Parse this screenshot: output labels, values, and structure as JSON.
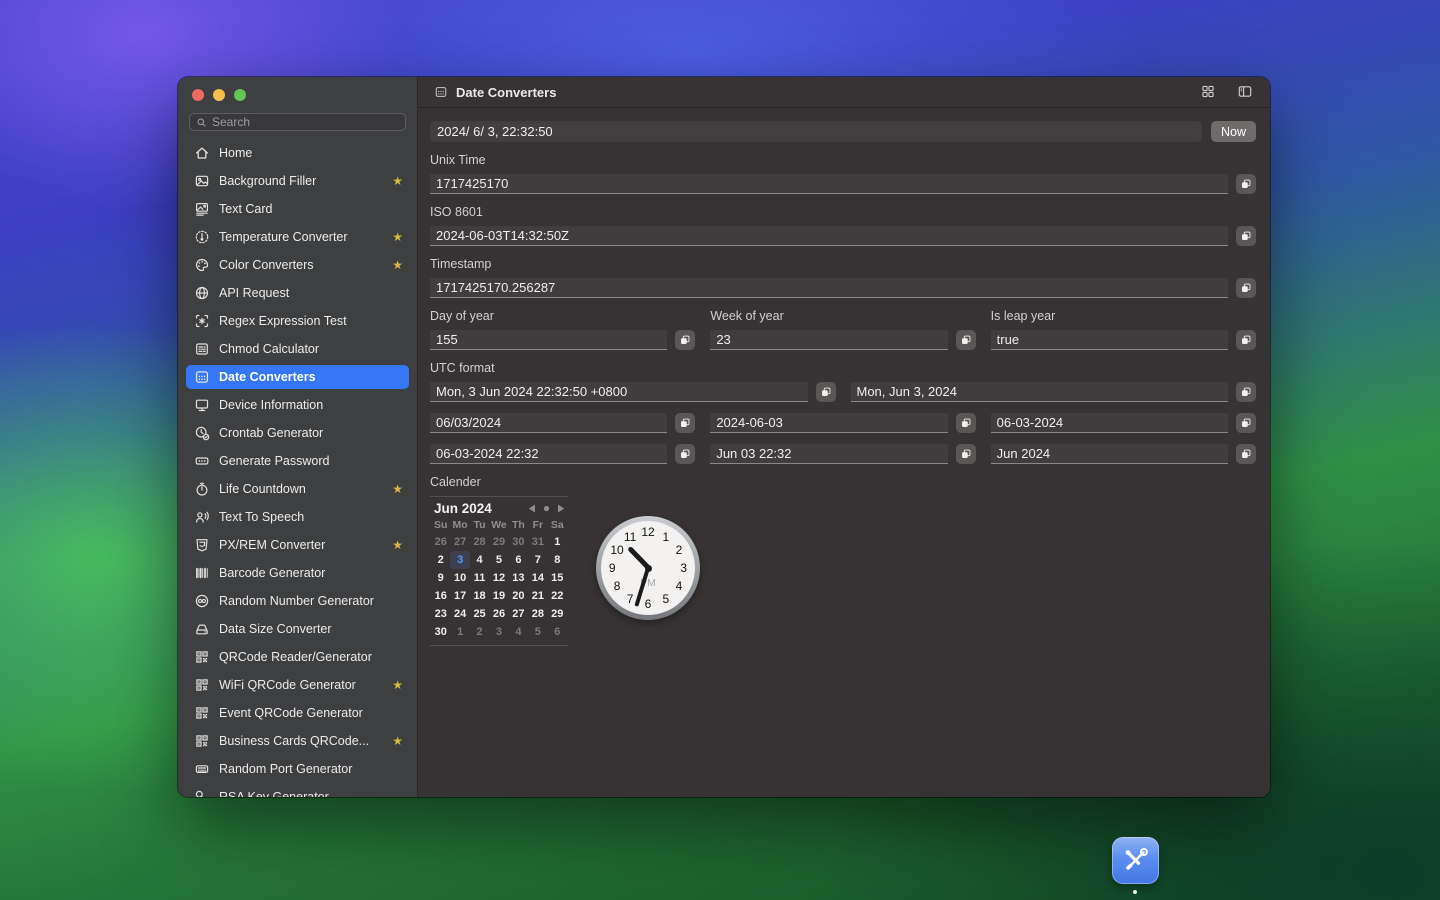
{
  "colors": {
    "accent": "#3577f6",
    "star_gold": "#d7b83d",
    "selected_day": "#4f9cf8"
  },
  "window": {
    "sidebar": {
      "search_placeholder": "Search",
      "items": [
        {
          "label": "Home",
          "icon": "home-icon",
          "starred": false,
          "selected": false
        },
        {
          "label": "Background Filler",
          "icon": "image-icon",
          "starred": true,
          "selected": false
        },
        {
          "label": "Text Card",
          "icon": "text-card-icon",
          "starred": false,
          "selected": false
        },
        {
          "label": "Temperature Converter",
          "icon": "thermometer-icon",
          "starred": true,
          "selected": false
        },
        {
          "label": "Color Converters",
          "icon": "palette-icon",
          "starred": true,
          "selected": false
        },
        {
          "label": "API Request",
          "icon": "globe-icon",
          "starred": false,
          "selected": false
        },
        {
          "label": "Regex Expression Test",
          "icon": "regex-icon",
          "starred": false,
          "selected": false
        },
        {
          "label": "Chmod Calculator",
          "icon": "chmod-icon",
          "starred": false,
          "selected": false
        },
        {
          "label": "Date Converters",
          "icon": "calendar-icon",
          "starred": false,
          "selected": true
        },
        {
          "label": "Device Information",
          "icon": "device-icon",
          "starred": false,
          "selected": false
        },
        {
          "label": "Crontab Generator",
          "icon": "crontab-icon",
          "starred": false,
          "selected": false
        },
        {
          "label": "Generate Password",
          "icon": "password-icon",
          "starred": false,
          "selected": false
        },
        {
          "label": "Life Countdown",
          "icon": "countdown-icon",
          "starred": true,
          "selected": false
        },
        {
          "label": "Text To Speech",
          "icon": "speech-icon",
          "starred": false,
          "selected": false
        },
        {
          "label": "PX/REM Converter",
          "icon": "css-icon",
          "starred": true,
          "selected": false
        },
        {
          "label": "Barcode Generator",
          "icon": "barcode-icon",
          "starred": false,
          "selected": false
        },
        {
          "label": "Random Number Generator",
          "icon": "infinity-icon",
          "starred": false,
          "selected": false
        },
        {
          "label": "Data Size Converter",
          "icon": "data-size-icon",
          "starred": false,
          "selected": false
        },
        {
          "label": "QRCode Reader/Generator",
          "icon": "qrcode-icon",
          "starred": false,
          "selected": false
        },
        {
          "label": "WiFi QRCode Generator",
          "icon": "qrcode-icon",
          "starred": true,
          "selected": false
        },
        {
          "label": "Event QRCode Generator",
          "icon": "qrcode-icon",
          "starred": false,
          "selected": false
        },
        {
          "label": "Business Cards QRCode...",
          "icon": "qrcode-icon",
          "starred": true,
          "selected": false
        },
        {
          "label": "Random Port Generator",
          "icon": "port-icon",
          "starred": false,
          "selected": false
        },
        {
          "label": "RSA Key Generator",
          "icon": "key-icon",
          "starred": false,
          "selected": false
        }
      ]
    },
    "titlebar": {
      "title": "Date Converters"
    },
    "main": {
      "now_row": {
        "value": "2024/ 6/ 3, 22:32:50",
        "now_label": "Now"
      },
      "unix": {
        "label": "Unix Time",
        "value": "1717425170"
      },
      "iso": {
        "label": "ISO 8601",
        "value": "2024-06-03T14:32:50Z"
      },
      "timestamp": {
        "label": "Timestamp",
        "value": "1717425170.256287"
      },
      "day_of_year": {
        "label": "Day of year",
        "value": "155"
      },
      "week_of_year": {
        "label": "Week of year",
        "value": "23"
      },
      "leap_year": {
        "label": "Is leap year",
        "value": "true"
      },
      "utc": {
        "label": "UTC format",
        "values": [
          "Mon, 3 Jun 2024 22:32:50 +0800",
          "Mon, Jun 3, 2024"
        ]
      },
      "date_rows": [
        [
          "06/03/2024",
          "2024-06-03",
          "06-03-2024"
        ],
        [
          "06-03-2024 22:32",
          "Jun 03 22:32",
          "Jun 2024"
        ]
      ],
      "calendar": {
        "label": "Calender",
        "month": "Jun 2024",
        "weekdays": [
          "Su",
          "Mo",
          "Tu",
          "We",
          "Th",
          "Fr",
          "Sa"
        ],
        "days": [
          {
            "t": "26",
            "m": 1
          },
          {
            "t": "27",
            "m": 1
          },
          {
            "t": "28",
            "m": 1
          },
          {
            "t": "29",
            "m": 1
          },
          {
            "t": "30",
            "m": 1
          },
          {
            "t": "31",
            "m": 1
          },
          {
            "t": "1"
          },
          {
            "t": "2"
          },
          {
            "t": "3",
            "sel": 1
          },
          {
            "t": "4"
          },
          {
            "t": "5"
          },
          {
            "t": "6"
          },
          {
            "t": "7"
          },
          {
            "t": "8"
          },
          {
            "t": "9"
          },
          {
            "t": "10"
          },
          {
            "t": "11"
          },
          {
            "t": "12"
          },
          {
            "t": "13"
          },
          {
            "t": "14"
          },
          {
            "t": "15"
          },
          {
            "t": "16"
          },
          {
            "t": "17"
          },
          {
            "t": "18"
          },
          {
            "t": "19"
          },
          {
            "t": "20"
          },
          {
            "t": "21"
          },
          {
            "t": "22"
          },
          {
            "t": "23"
          },
          {
            "t": "24"
          },
          {
            "t": "25"
          },
          {
            "t": "26"
          },
          {
            "t": "27"
          },
          {
            "t": "28"
          },
          {
            "t": "29"
          },
          {
            "t": "30"
          },
          {
            "t": "1",
            "m": 1
          },
          {
            "t": "2",
            "m": 1
          },
          {
            "t": "3",
            "m": 1
          },
          {
            "t": "4",
            "m": 1
          },
          {
            "t": "5",
            "m": 1
          },
          {
            "t": "6",
            "m": 1
          }
        ]
      },
      "clock": {
        "numerals": [
          "12",
          "1",
          "2",
          "3",
          "4",
          "5",
          "6",
          "7",
          "8",
          "9",
          "10",
          "11"
        ],
        "period": "PM",
        "hour_angle": 316,
        "minute_angle": 197
      }
    }
  }
}
